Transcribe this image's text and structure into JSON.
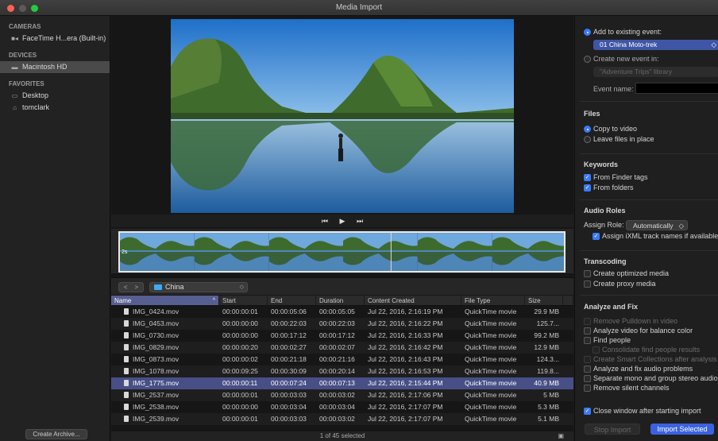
{
  "window": {
    "title": "Media Import"
  },
  "sidebar": {
    "sections": [
      {
        "heading": "CAMERAS",
        "items": [
          {
            "label": "FaceTime H...era (Built-in)",
            "icon": "camera-icon"
          }
        ]
      },
      {
        "heading": "DEVICES",
        "items": [
          {
            "label": "Macintosh HD",
            "icon": "drive-icon",
            "selected": true
          }
        ]
      },
      {
        "heading": "FAVORITES",
        "items": [
          {
            "label": "Desktop",
            "icon": "desktop-icon"
          },
          {
            "label": "tomclark",
            "icon": "home-icon"
          }
        ]
      }
    ],
    "archive_button": "Create Archive..."
  },
  "filmstrip": {
    "duration_label": "2s"
  },
  "nav": {
    "back": "<",
    "forward": ">",
    "folder": "China"
  },
  "table": {
    "columns": [
      "Name",
      "Start",
      "End",
      "Duration",
      "Content Created",
      "File Type",
      "Size"
    ],
    "rows": [
      {
        "name": "IMG_0424.mov",
        "start": "00:00:00:01",
        "end": "00:00:05:06",
        "duration": "00:00:05:05",
        "created": "Jul 22, 2016, 2:16:19 PM",
        "type": "QuickTime movie",
        "size": "29.9 MB"
      },
      {
        "name": "IMG_0453.mov",
        "start": "00:00:00:00",
        "end": "00:00:22:03",
        "duration": "00:00:22:03",
        "created": "Jul 22, 2016, 2:16:22 PM",
        "type": "QuickTime movie",
        "size": "125.7..."
      },
      {
        "name": "IMG_0730.mov",
        "start": "00:00:00:00",
        "end": "00:00:17:12",
        "duration": "00:00:17:12",
        "created": "Jul 22, 2016, 2:16:33 PM",
        "type": "QuickTime movie",
        "size": "99.2 MB"
      },
      {
        "name": "IMG_0829.mov",
        "start": "00:00:00:20",
        "end": "00:00:02:27",
        "duration": "00:00:02:07",
        "created": "Jul 22, 2016, 2:16:42 PM",
        "type": "QuickTime movie",
        "size": "12.9 MB"
      },
      {
        "name": "IMG_0873.mov",
        "start": "00:00:00:02",
        "end": "00:00:21:18",
        "duration": "00:00:21:16",
        "created": "Jul 22, 2016, 2:16:43 PM",
        "type": "QuickTime movie",
        "size": "124.3..."
      },
      {
        "name": "IMG_1078.mov",
        "start": "00:00:09:25",
        "end": "00:00:30:09",
        "duration": "00:00:20:14",
        "created": "Jul 22, 2016, 2:16:53 PM",
        "type": "QuickTime movie",
        "size": "119.8..."
      },
      {
        "name": "IMG_1775.mov",
        "start": "00:00:00:11",
        "end": "00:00:07:24",
        "duration": "00:00:07:13",
        "created": "Jul 22, 2016, 2:15:44 PM",
        "type": "QuickTime movie",
        "size": "40.9 MB",
        "selected": true
      },
      {
        "name": "IMG_2537.mov",
        "start": "00:00:00:01",
        "end": "00:00:03:03",
        "duration": "00:00:03:02",
        "created": "Jul 22, 2016, 2:17:06 PM",
        "type": "QuickTime movie",
        "size": "5 MB"
      },
      {
        "name": "IMG_2538.mov",
        "start": "00:00:00:00",
        "end": "00:00:03:04",
        "duration": "00:00:03:04",
        "created": "Jul 22, 2016, 2:17:07 PM",
        "type": "QuickTime movie",
        "size": "5.3 MB"
      },
      {
        "name": "IMG_2539.mov",
        "start": "00:00:00:01",
        "end": "00:00:03:03",
        "duration": "00:00:03:02",
        "created": "Jul 22, 2016, 2:17:07 PM",
        "type": "QuickTime movie",
        "size": "5.1 MB"
      }
    ],
    "status": "1 of 45 selected"
  },
  "options": {
    "add_existing": "Add to existing event:",
    "existing_event": "01 China Moto-trek",
    "create_new": "Create new event in:",
    "new_library": "\"Adventure Trips\" library",
    "event_name_label": "Event name:",
    "files_title": "Files",
    "copy_to": "Copy to video",
    "leave_files": "Leave files in place",
    "keywords_title": "Keywords",
    "from_finder": "From Finder tags",
    "from_folders": "From folders",
    "audio_title": "Audio Roles",
    "assign_role_label": "Assign Role:",
    "assign_role_value": "Automatically",
    "assign_ixml": "Assign iXML track names if available",
    "transcoding_title": "Transcoding",
    "optimized": "Create optimized media",
    "proxy": "Create proxy media",
    "analyze_title": "Analyze and Fix",
    "remove_pulldown": "Remove Pulldown in video",
    "analyze_balance": "Analyze video for balance color",
    "find_people": "Find people",
    "consolidate": "Consolidate find people results",
    "smart_collections": "Create Smart Collections after analysis",
    "audio_problems": "Analyze and fix audio problems",
    "mono_stereo": "Separate mono and group stereo audio",
    "silent": "Remove silent channels",
    "close_window": "Close window after starting import",
    "stop_import": "Stop Import",
    "import_selected": "Import Selected"
  },
  "colors": {
    "accent": "#3a7bf7",
    "selection": "#484f86"
  }
}
